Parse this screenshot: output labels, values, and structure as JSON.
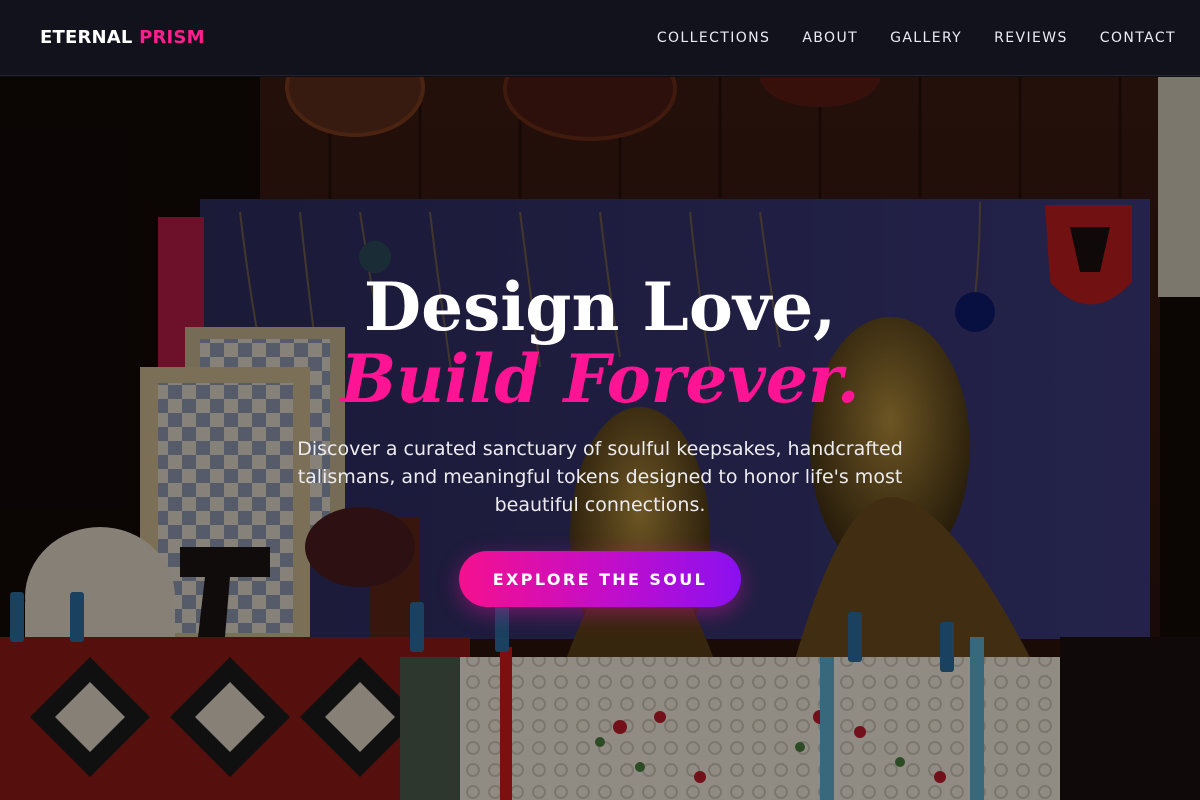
{
  "brand": {
    "word1": "ETERNAL",
    "word2": "PRISM"
  },
  "nav": {
    "items": [
      {
        "label": "COLLECTIONS"
      },
      {
        "label": "ABOUT"
      },
      {
        "label": "GALLERY"
      },
      {
        "label": "REVIEWS"
      },
      {
        "label": "CONTACT"
      }
    ]
  },
  "hero": {
    "headline_line1": "Design Love,",
    "headline_line2": "Build Forever.",
    "subtext": "Discover a curated sanctuary of soulful keepsakes, handcrafted talismans, and meaningful tokens designed to honor life's most beautiful connections.",
    "cta_label": "EXPLORE THE SOUL"
  },
  "colors": {
    "accent": "#ff1493",
    "cta_gradient_start": "#f5108e",
    "cta_gradient_end": "#8a10f0",
    "nav_background": "#12121c"
  }
}
